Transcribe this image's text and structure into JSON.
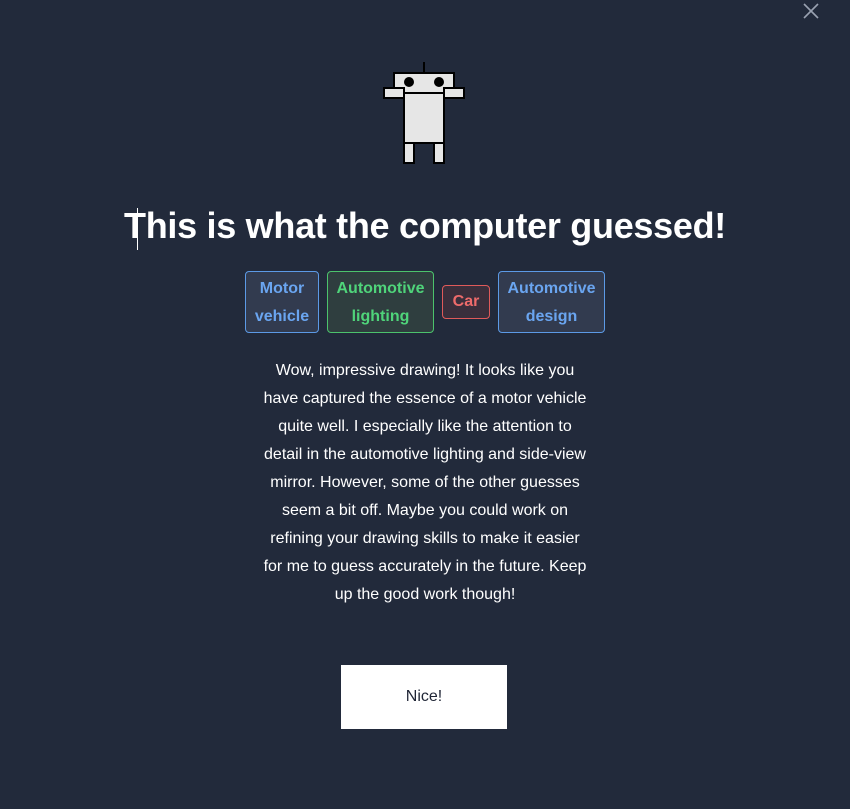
{
  "modal": {
    "title": "This is what the computer guessed!",
    "tags": [
      {
        "line1": "Motor",
        "line2": "vehicle",
        "color": "#6aa5f0"
      },
      {
        "line1": "Automotive",
        "line2": "lighting",
        "color": "#4fd47a"
      },
      {
        "line1": "Car",
        "color": "#ee6b6b"
      },
      {
        "line1": "Automotive",
        "line2": "design",
        "color": "#6aa5f0"
      }
    ],
    "message": "Wow, impressive drawing! It looks like you have captured the essence of a motor vehicle quite well. I especially like the attention to detail in the automotive lighting and side-view mirror. However, some of the other guesses seem a bit off. Maybe you could work on refining your drawing skills to make it easier for me to guess accurately in the future. Keep up the good work though!",
    "button_label": "Nice!",
    "icons": {
      "close": "close-icon",
      "mascot": "robot-icon"
    }
  },
  "colors": {
    "background": "#222a3b",
    "text": "#ffffff",
    "button_bg": "#ffffff",
    "button_text": "#1f2535"
  }
}
